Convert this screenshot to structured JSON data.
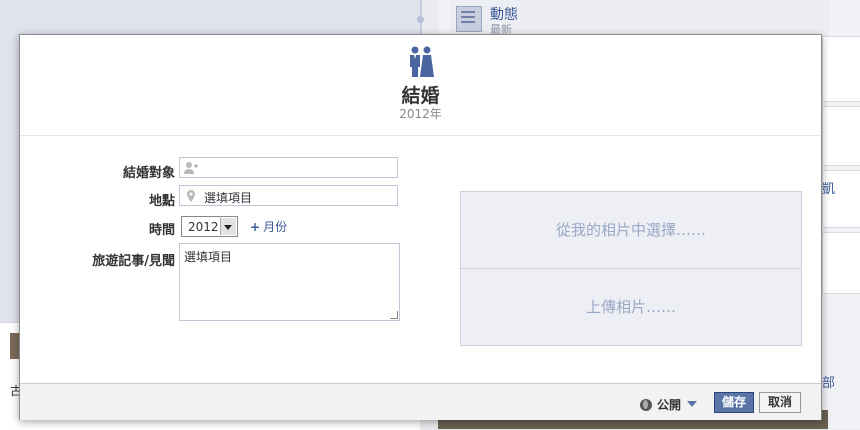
{
  "background": {
    "activity": {
      "title": "動態",
      "subtitle": "最新"
    },
    "left_text": "古",
    "right_link_top": "凱",
    "right_link_bottom": "部"
  },
  "dialog": {
    "title": "結婚",
    "subtitle": "2012年",
    "icon": "couple-icon",
    "fields": {
      "partner": {
        "label": "結婚對象",
        "value": "",
        "icon": "add-person-icon"
      },
      "location": {
        "label": "地點",
        "value": "選填項目",
        "icon": "map-pin-icon"
      },
      "time": {
        "label": "時間",
        "year": "2012",
        "add_month": "月份"
      },
      "story": {
        "label": "旅遊記事/見聞",
        "value": "選填項目"
      }
    },
    "photo": {
      "choose": "從我的相片中選擇……",
      "upload": "上傳相片……"
    },
    "footer": {
      "privacy": "公開",
      "save": "儲存",
      "cancel": "取消"
    }
  }
}
